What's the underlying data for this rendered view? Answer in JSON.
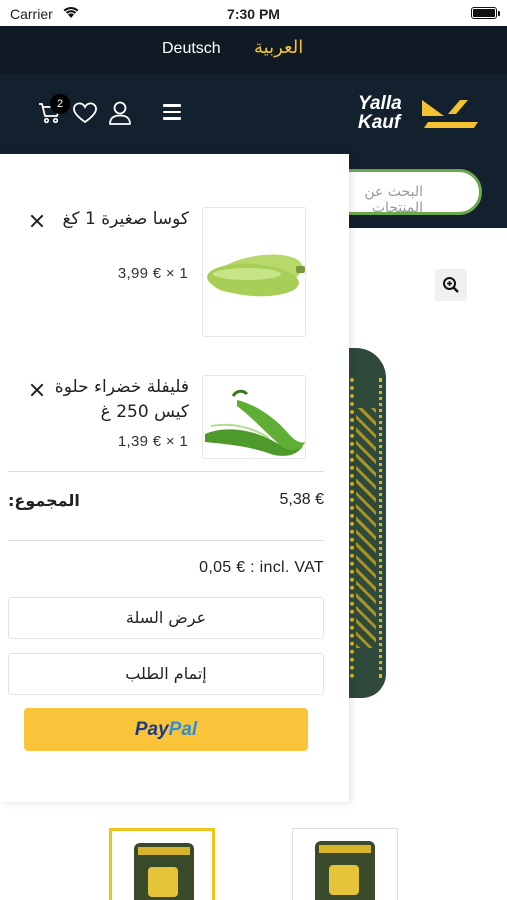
{
  "status_bar": {
    "carrier": "Carrier",
    "time": "7:30 PM"
  },
  "language_bar": {
    "german": "Deutsch",
    "arabic": "العربية",
    "active_color": "#f2c230"
  },
  "header": {
    "logo_line1": "Yalla",
    "logo_line2": "Kauf",
    "cart_count": "2",
    "icons": [
      "menu-icon",
      "user-icon",
      "heart-icon",
      "cart-icon"
    ]
  },
  "search": {
    "placeholder": "البحث عن المنتجات"
  },
  "cart": {
    "items": [
      {
        "name": "كوسا صغيرة 1 كغ",
        "price": "3,99 € × 1"
      },
      {
        "name": "فليفلة خضراء حلوة كيس 250 غ",
        "price": "1,39 € × 1"
      }
    ],
    "total_label": "المجموع:",
    "total_value": "5,38 €",
    "vat": "0,05 € : incl. VAT",
    "view_cart": "عرض السلة",
    "checkout": "إتمام الطلب",
    "paypal_part1": "Pay",
    "paypal_part2": "Pal"
  },
  "colors": {
    "header_bg": "#13212e",
    "accent_yellow": "#f2c230",
    "search_border": "#6aa84f",
    "paypal_bg": "#f9c43a"
  }
}
